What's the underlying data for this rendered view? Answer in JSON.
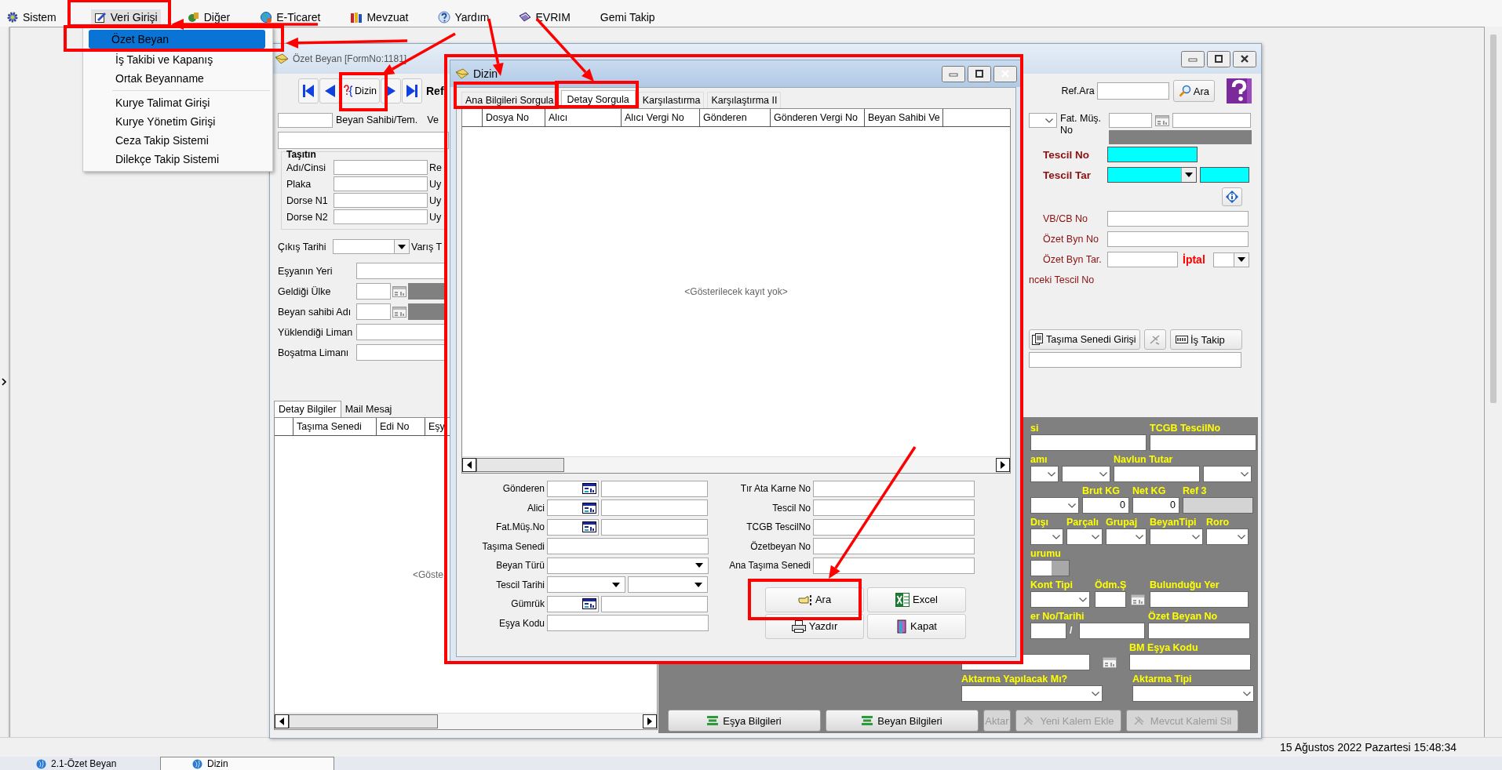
{
  "menu_bar": [
    {
      "label": "Sistem",
      "selected": false
    },
    {
      "label": "Veri Girişi",
      "selected": true
    },
    {
      "label": "Diğer",
      "selected": false
    },
    {
      "label": "E-Ticaret",
      "selected": false
    },
    {
      "label": "Mevzuat",
      "selected": false
    },
    {
      "label": "Yardım",
      "selected": false
    },
    {
      "label": "EVRIM",
      "selected": false
    },
    {
      "label": "Gemi Takip",
      "selected": false
    }
  ],
  "veri_girisi_menu": [
    [
      {
        "label": "Özet Beyan",
        "selected": true
      },
      {
        "label": "İş Takibi ve Kapanış",
        "selected": false
      },
      {
        "label": "Ortak Beyanname",
        "selected": false
      }
    ],
    [
      {
        "label": "Kurye Talimat Girişi",
        "selected": false
      },
      {
        "label": "Kurye Yönetim Girişi",
        "selected": false
      },
      {
        "label": "Ceza Takip Sistemi",
        "selected": false
      },
      {
        "label": "Dilekçe Takip Sistemi",
        "selected": false
      }
    ]
  ],
  "ozet_beyan": {
    "title": "Özet Beyan [FormNo:1181]",
    "active": false,
    "dizin_button": "Dizin",
    "ref_cut": "Ref",
    "ref_ara_label": "Ref.Ara",
    "ara_button": "Ara",
    "owner_label": "Beyan Sahibi/Tem.",
    "owner_cut": "Ve",
    "vehicle_group": {
      "title": "Taşıtın",
      "rows": [
        {
          "label": "Adı/Cinsi",
          "cut": "Re"
        },
        {
          "label": "Plaka",
          "cut": "Uy"
        },
        {
          "label": "Dorse N1",
          "cut": "Uy"
        },
        {
          "label": "Dorse N2",
          "cut": "Uy"
        }
      ]
    },
    "exit_date": {
      "label": "Çıkış Tarihi",
      "cut": "Varış T"
    },
    "left_rows": [
      {
        "label": "Eşyanın Yeri",
        "kind": "text"
      },
      {
        "label": "Geldiği Ülke",
        "kind": "lookup"
      },
      {
        "label": "Beyan sahibi Adı",
        "kind": "lookup"
      },
      {
        "label": "Yüklendiği Liman",
        "kind": "text"
      },
      {
        "label": "Boşatma Limanı",
        "kind": "text"
      }
    ],
    "fat_label": "Fat. Müş. No",
    "tescil_no_label": "Tescil No",
    "tescil_tar_label": "Tescil Tar",
    "right_rows": [
      {
        "label": "VB/CB No"
      },
      {
        "label": "Özet Byn No"
      }
    ],
    "ozet_tar_label": "Özet Byn Tar.",
    "iptal_label": "İptal",
    "onceki_label": "nceki Tescil No",
    "tasima_button": "Taşıma Senedi Girişi",
    "is_takip_button": "İş Takip",
    "detail_tabs": [
      {
        "label": "Detay Bilgiler",
        "selected": true
      },
      {
        "label": "Mail Mesaj",
        "selected": false
      }
    ],
    "detail_columns": [
      "Taşıma Senedi",
      "Edi No",
      "Eşy"
    ],
    "detail_empty": "<Göste",
    "dark_rows": [
      [
        {
          "label": "si",
          "kind": "text"
        },
        {
          "label": "TCGB TescilNo",
          "kind": "text"
        }
      ],
      [
        {
          "label": "amı",
          "kind": "combo"
        },
        {
          "kind": "combo"
        },
        {
          "label": "Navlun Tutar",
          "kind": "text"
        },
        {
          "kind": "combo"
        }
      ],
      [
        {
          "kind": "combo"
        },
        {
          "label": "Brut KG",
          "kind": "number",
          "value": "0"
        },
        {
          "label": "Net KG",
          "kind": "number",
          "value": "0"
        },
        {
          "label": "Ref 3",
          "kind": "readonly"
        }
      ],
      [
        {
          "label": "Dışı",
          "kind": "combo"
        },
        {
          "label": "Parçalı",
          "kind": "combo"
        },
        {
          "label": "Grupaj",
          "kind": "combo"
        },
        {
          "label": "BeyanTipi",
          "kind": "combo"
        },
        {
          "label": "Roro",
          "kind": "combo"
        }
      ],
      [
        {
          "label": "urumu",
          "kind": "toggle"
        }
      ],
      [
        {
          "label": "Kont Tipi",
          "kind": "combo"
        },
        {
          "label": "Ödm.Ş",
          "kind": "text"
        },
        {
          "kind": "lookup"
        },
        {
          "label": "Bulunduğu Yer",
          "kind": "text"
        }
      ],
      [
        {
          "label": "er No/Tarihi",
          "kind": "text"
        },
        {
          "kind": "slash",
          "text": "/"
        },
        {
          "kind": "text"
        },
        {
          "label": "Özet Beyan No",
          "kind": "text"
        }
      ],
      [
        {
          "kind": "text"
        },
        {
          "kind": "lookup"
        },
        {
          "label": "BM Eşya Kodu",
          "kind": "text"
        }
      ],
      [
        {
          "label": "Aktarma Yapılacak Mı?",
          "kind": "combo"
        },
        {
          "label": "Aktarma Tipi",
          "kind": "combo"
        }
      ]
    ],
    "bottom_buttons": [
      {
        "label": "Eşya Bilgileri",
        "disabled": false
      },
      {
        "label": "Beyan Bilgileri",
        "disabled": false
      },
      {
        "label": "Aktar",
        "disabled": true
      },
      {
        "label": "Yeni Kalem Ekle",
        "disabled": true
      },
      {
        "label": "Mevcut Kalemi Sil",
        "disabled": true
      }
    ]
  },
  "dizin": {
    "title": "Dizin",
    "active": true,
    "tabs": [
      {
        "label": "Ana Bilgileri Sorgula",
        "selected": false
      },
      {
        "label": "Detay Sorgula",
        "selected": true
      },
      {
        "label": "Karşılastırma",
        "selected": false
      },
      {
        "label": "Karşılaştırma II",
        "selected": false
      }
    ],
    "columns": [
      "Dosya No",
      "Alıcı",
      "Alıcı Vergi No",
      "Gönderen",
      "Gönderen Vergi No",
      "Beyan Sahibi Ve"
    ],
    "empty_text": "<Gösterilecek kayıt yok>",
    "left_fields": [
      {
        "label": "Gönderen",
        "kind": "lookup"
      },
      {
        "label": "Alici",
        "kind": "lookup"
      },
      {
        "label": "Fat.Müş.No",
        "kind": "lookup"
      },
      {
        "label": "Taşıma Senedi",
        "kind": "text"
      },
      {
        "label": "Beyan Türü",
        "kind": "combo"
      },
      {
        "label": "Tescil Tarihi",
        "kind": "date_pair"
      },
      {
        "label": "Gümrük",
        "kind": "lookup"
      },
      {
        "label": "Eşya Kodu",
        "kind": "text"
      }
    ],
    "right_fields": [
      "Tır Ata Karne No",
      "Tescil No",
      "TCGB TescilNo",
      "Özetbeyan No",
      "Ana Taşıma Senedi"
    ],
    "buttons": [
      "Ara",
      "Excel",
      "Yazdır",
      "Kapat"
    ]
  },
  "status_bar": {
    "clock": "15 Ağustos 2022 Pazartesi 15:48:34"
  },
  "taskbar": [
    {
      "label": "2.1-Özet Beyan",
      "selected": false
    },
    {
      "label": "Dizin",
      "selected": true
    }
  ]
}
